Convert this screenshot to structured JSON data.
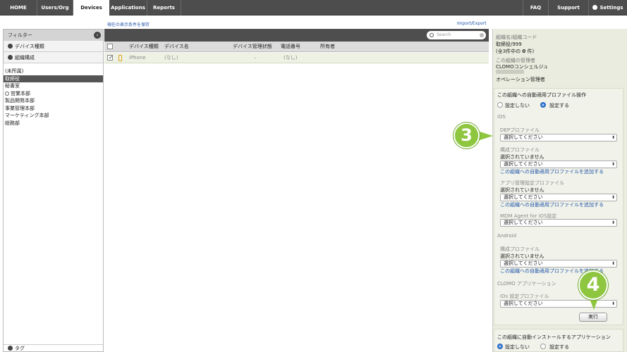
{
  "nav": {
    "tabs": [
      "HOME",
      "Users/Org",
      "Devices",
      "Applications",
      "Reports"
    ],
    "active": "Devices",
    "faq": "FAQ",
    "support": "Support",
    "settings": "Settings"
  },
  "sidebar": {
    "header": "フィルター",
    "device_type": "デバイス種類",
    "org_structure": "組織構成",
    "items": [
      "(未所属)",
      "取締役",
      "秘書室",
      "営業本部",
      "製品開発本部",
      "事業管理本部",
      "マーケティング本部",
      "総務部"
    ],
    "selected": "取締役",
    "tag": "タグ"
  },
  "main": {
    "save_conditions": "現在の表示条件を保存",
    "import_export": "Import/Export",
    "search_placeholder": "Search",
    "columns": [
      "デバイス種類",
      "デバイス名",
      "デバイス管理状態",
      "電話番号",
      "所有者"
    ],
    "rows": [
      {
        "type": "iPhone",
        "name": "(なし)",
        "status": "–",
        "phone": "(なし)",
        "owner": ""
      }
    ]
  },
  "right_panel": {
    "org_code_label": "組織名/組織コード",
    "org_code_value": "取締役/999",
    "count_prefix": "(全3件中の ",
    "count_value": "0",
    "count_suffix": " 件)",
    "admin_label": "この組織の管理者",
    "admin_value": "CLOMOコンシェルジュ",
    "admin_role": "オペレーション管理者",
    "ops_title": "この組織への自動適用プロファイル操作",
    "radio_off": "設定しない",
    "radio_on": "設定する",
    "ios_label": "iOS",
    "dep_profile": "DEPプロファイル",
    "select_placeholder": "選択してください",
    "config_profile": "構成プロファイル",
    "not_selected": "選択されていません",
    "add_link": "この組織への自動適用プロファイルを追加する",
    "app_config_profile": "アプリ管理設定プロファイル",
    "mdm_agent": "MDM Agent for iOS設定",
    "android_label": "Android",
    "clomo_app_label": "CLOMO アプリケーション",
    "ids_profile": "IDs 設定プロファイル",
    "execute": "実行",
    "apps_title": "この組織に自動インストールするアプリケーション",
    "apps_radio_off": "設定しない",
    "apps_radio_on": "設定する"
  },
  "steps": {
    "step3": "3",
    "step4": "4"
  },
  "colors": {
    "badge": "#8ec63f",
    "topbar": "#4d4d4d",
    "panel": "#e9ecde",
    "link": "#2255aa"
  }
}
